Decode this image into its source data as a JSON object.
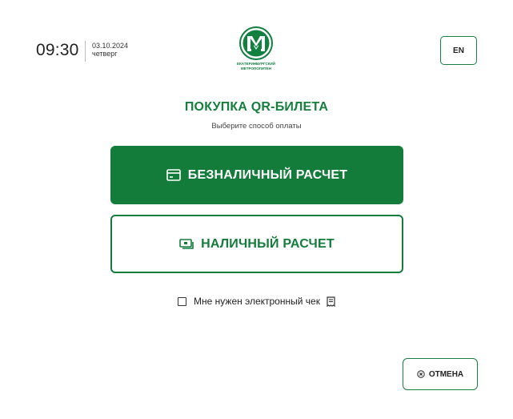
{
  "header": {
    "time": "09:30",
    "date": "03.10.2024",
    "weekday": "четверг",
    "logo_line1": "ЕКАТЕРИНБУРГСКИЙ",
    "logo_line2": "МЕТРОПОЛИТЕН",
    "language_button": "EN"
  },
  "main": {
    "title": "ПОКУПКА QR-БИЛЕТА",
    "subtitle": "Выберите способ оплаты",
    "card_payment_label": "БЕЗНАЛИЧНЫЙ РАСЧЕТ",
    "cash_payment_label": "НАЛИЧНЫЙ РАСЧЕТ",
    "receipt_label": "Мне нужен электронный чек",
    "receipt_checked": false
  },
  "footer": {
    "cancel_label": "ОТМЕНА"
  },
  "icons": {
    "card": "credit-card-icon",
    "cash": "cash-icon",
    "receipt": "receipt-icon",
    "cancel": "close-circle-icon",
    "logo": "metro-logo-icon"
  },
  "colors": {
    "brand_green": "#137c3b",
    "text_dark": "#212121",
    "background": "#ffffff"
  }
}
